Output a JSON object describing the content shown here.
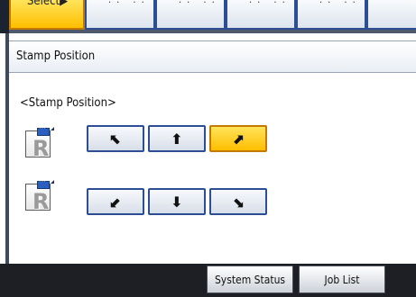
{
  "header": {
    "select_label": "Select▶",
    "tab_marks": [
      "·· ··",
      "·· ··",
      "·· ··",
      "·· ··"
    ]
  },
  "panel": {
    "title": "Stamp Position",
    "section_label": "<Stamp Position>"
  },
  "icon_letter": "R",
  "position_buttons": {
    "top_left": "⬉",
    "top_center": "⬆",
    "top_right": "⬈",
    "bottom_left": "⬋",
    "bottom_center": "⬇",
    "bottom_right": "⬊",
    "selected": "top_right"
  },
  "footer": {
    "system_status": "System Status",
    "job_list": "Job List"
  },
  "colors": {
    "selected_fill": "#ffbe00",
    "button_border": "#2b4e95",
    "bottom_bar": "#1d1f24"
  }
}
